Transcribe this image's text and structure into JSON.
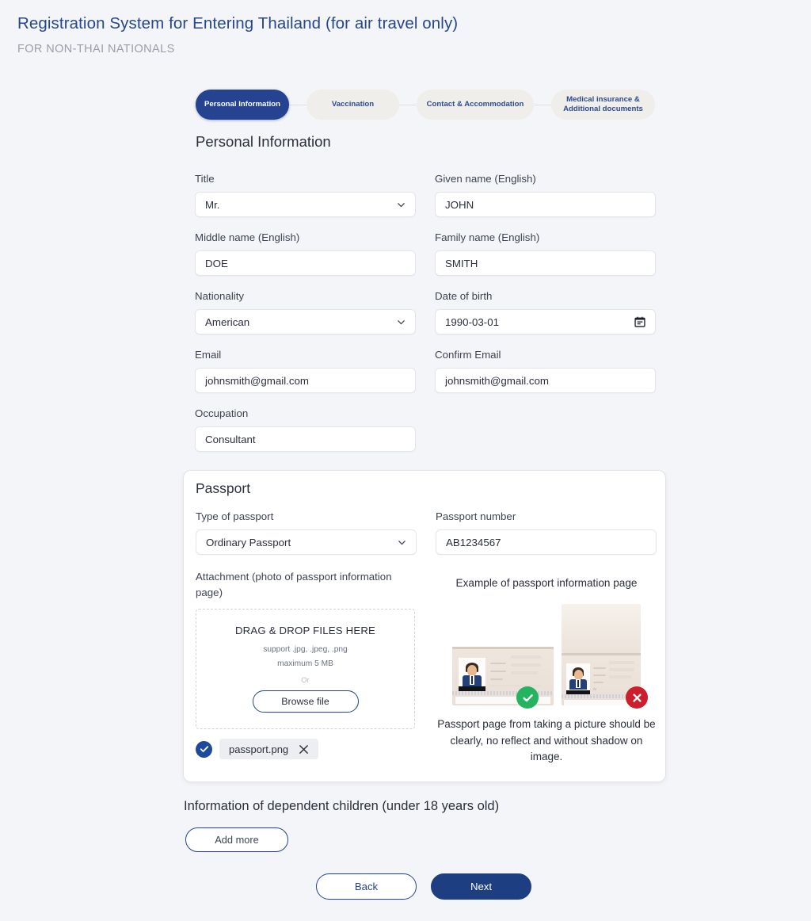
{
  "header": {
    "title": "Registration System for Entering Thailand (for air travel only)",
    "subtitle": "FOR NON-THAI NATIONALS"
  },
  "stepper": {
    "steps": [
      {
        "label": "Personal Information",
        "active": true
      },
      {
        "label": "Vaccination",
        "active": false
      },
      {
        "label": "Contact & Accommodation",
        "active": false
      },
      {
        "label": "Medical insurance &\nAdditional documents",
        "active": false
      }
    ]
  },
  "personal": {
    "section_title": "Personal Information",
    "fields": {
      "title": {
        "label": "Title",
        "value": "Mr.",
        "type": "select"
      },
      "given_name": {
        "label": "Given name (English)",
        "value": "JOHN",
        "type": "text"
      },
      "middle_name": {
        "label": "Middle name (English)",
        "value": "DOE",
        "type": "text"
      },
      "family_name": {
        "label": "Family name (English)",
        "value": "SMITH",
        "type": "text"
      },
      "nationality": {
        "label": "Nationality",
        "value": "American",
        "type": "select"
      },
      "date_of_birth": {
        "label": "Date of birth",
        "value": "1990-03-01",
        "type": "date"
      },
      "email": {
        "label": "Email",
        "value": "johnsmith@gmail.com",
        "type": "text"
      },
      "confirm_email": {
        "label": "Confirm Email",
        "value": "johnsmith@gmail.com",
        "type": "text"
      },
      "occupation": {
        "label": "Occupation",
        "value": "Consultant",
        "type": "text"
      }
    }
  },
  "passport": {
    "card_title": "Passport",
    "type_label": "Type of passport",
    "type_value": "Ordinary Passport",
    "number_label": "Passport number",
    "number_value": "AB1234567",
    "attachment_label": "Attachment (photo of passport information page)",
    "dropzone": {
      "title": "DRAG & DROP FILES HERE",
      "support": "support .jpg, .jpeg, .png",
      "max_size": "maximum 5 MB",
      "or": "Or",
      "browse_label": "Browse file"
    },
    "attached_file": {
      "name": "passport.png",
      "status_icon": "check-circle-icon",
      "remove_icon": "close-icon"
    },
    "example": {
      "title": "Example of passport information page",
      "good_badge_icon": "check-circle-icon",
      "bad_badge_icon": "close-circle-icon",
      "note": "Passport page from taking a picture should be clearly, no reflect and without shadow on image."
    }
  },
  "dependents": {
    "title": "Information of dependent children (under 18 years old)",
    "add_more_label": "Add more"
  },
  "footer": {
    "back_label": "Back",
    "next_label": "Next"
  },
  "colors": {
    "page_bg": "#f4f5f8",
    "brand_navy": "#254390",
    "title_navy": "#26478d",
    "next_button": "#1d3f82",
    "inactive_step_bg": "#f0eeeb",
    "success_green": "#24b35e",
    "error_red": "#cc1f2b",
    "subtitle_gray": "#9a9ea8"
  }
}
